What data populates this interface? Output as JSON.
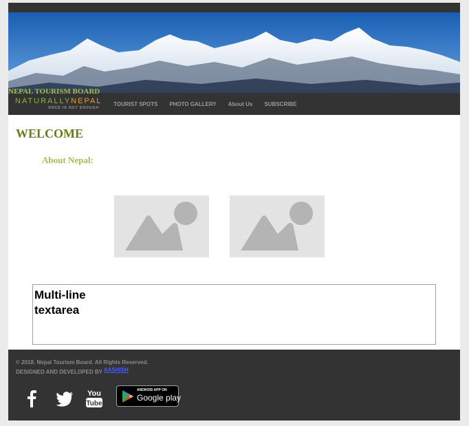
{
  "header": {
    "tourism_board": "NEPAL TOURISM BOARD",
    "brand_part1": "NATURALLY",
    "brand_part2": "NEPAL",
    "brand_tagline": "ONCE IS NOT ENOUGH"
  },
  "nav": {
    "items": [
      {
        "label": "TOURIST SPOTS"
      },
      {
        "label": "PHOTO GALLERY"
      },
      {
        "label": "About Us"
      },
      {
        "label": "SUBSCRIBE"
      }
    ]
  },
  "main": {
    "welcome": "WELCOME",
    "about": "About Nepal:",
    "textarea_value": "Multi-line\ntextarea"
  },
  "footer": {
    "copyright": "© 2018. Nepal Tourism Board. All Rights Reserved.",
    "designed_by": "DESIGNED AND DEVELOPED BY",
    "designer": "AASHISH",
    "social": [
      {
        "icon": "facebook-icon"
      },
      {
        "icon": "twitter-icon"
      },
      {
        "icon": "youtube-icon",
        "label_top": "You",
        "label_bottom": "Tube"
      }
    ],
    "google_play": {
      "small": "ANDROID APP ON",
      "big": "Google play"
    }
  },
  "colors": {
    "dark_bar": "#333333",
    "welcome": "#6b7a1e",
    "about": "#9fbf5a",
    "link": "#4a5cff"
  }
}
